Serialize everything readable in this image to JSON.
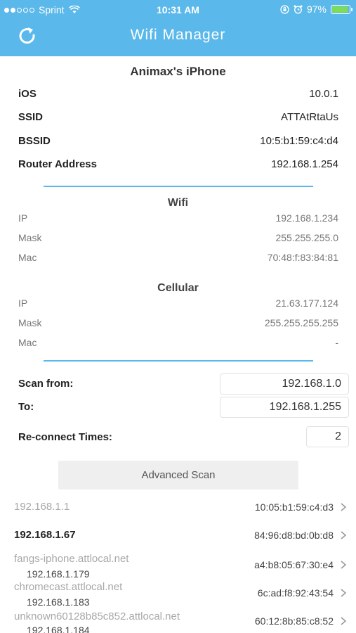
{
  "status_bar": {
    "carrier": "Sprint",
    "time": "10:31 AM",
    "battery_pct": "97%",
    "battery_level": 0.97,
    "signal_bars_filled": 2,
    "signal_bars_total": 5
  },
  "nav": {
    "title": "Wifi Manager",
    "refresh_icon": "refresh-icon"
  },
  "device": {
    "name": "Animax's iPhone",
    "info": [
      {
        "label": "iOS",
        "value": "10.0.1"
      },
      {
        "label": "SSID",
        "value": "ATTAtRtaUs"
      },
      {
        "label": "BSSID",
        "value": "10:5:b1:59:c4:d4"
      },
      {
        "label": "Router Address",
        "value": "192.168.1.254"
      }
    ]
  },
  "wifi": {
    "title": "Wifi",
    "rows": [
      {
        "label": "IP",
        "value": "192.168.1.234"
      },
      {
        "label": "Mask",
        "value": "255.255.255.0"
      },
      {
        "label": "Mac",
        "value": "70:48:f:83:84:81"
      }
    ]
  },
  "cellular": {
    "title": "Cellular",
    "rows": [
      {
        "label": "IP",
        "value": "21.63.177.124"
      },
      {
        "label": "Mask",
        "value": "255.255.255.255"
      },
      {
        "label": "Mac",
        "value": "-"
      }
    ]
  },
  "scan": {
    "from_label": "Scan from:",
    "from_value": "192.168.1.0",
    "to_label": "To:",
    "to_value": "192.168.1.255",
    "reconnect_label": "Re-connect Times:",
    "reconnect_value": "2",
    "advanced_button": "Advanced Scan"
  },
  "devices": [
    {
      "host": "192.168.1.1",
      "sub": "",
      "mac": "10:05:b1:59:c4:d3"
    },
    {
      "host": "192.168.1.67",
      "sub": "",
      "mac": "84:96:d8:bd:0b:d8"
    },
    {
      "host": "fangs-iphone.attlocal.net",
      "sub": "192.168.1.179",
      "mac": "a4:b8:05:67:30:e4"
    },
    {
      "host": "chromecast.attlocal.net",
      "sub": "192.168.1.183",
      "mac": "6c:ad:f8:92:43:54"
    },
    {
      "host": "unknown60128b85c852.attlocal.net",
      "sub": "192.168.1.184",
      "mac": "60:12:8b:85:c8:52"
    }
  ],
  "colors": {
    "accent": "#5ab8ea",
    "battery": "#7ddc5a"
  }
}
